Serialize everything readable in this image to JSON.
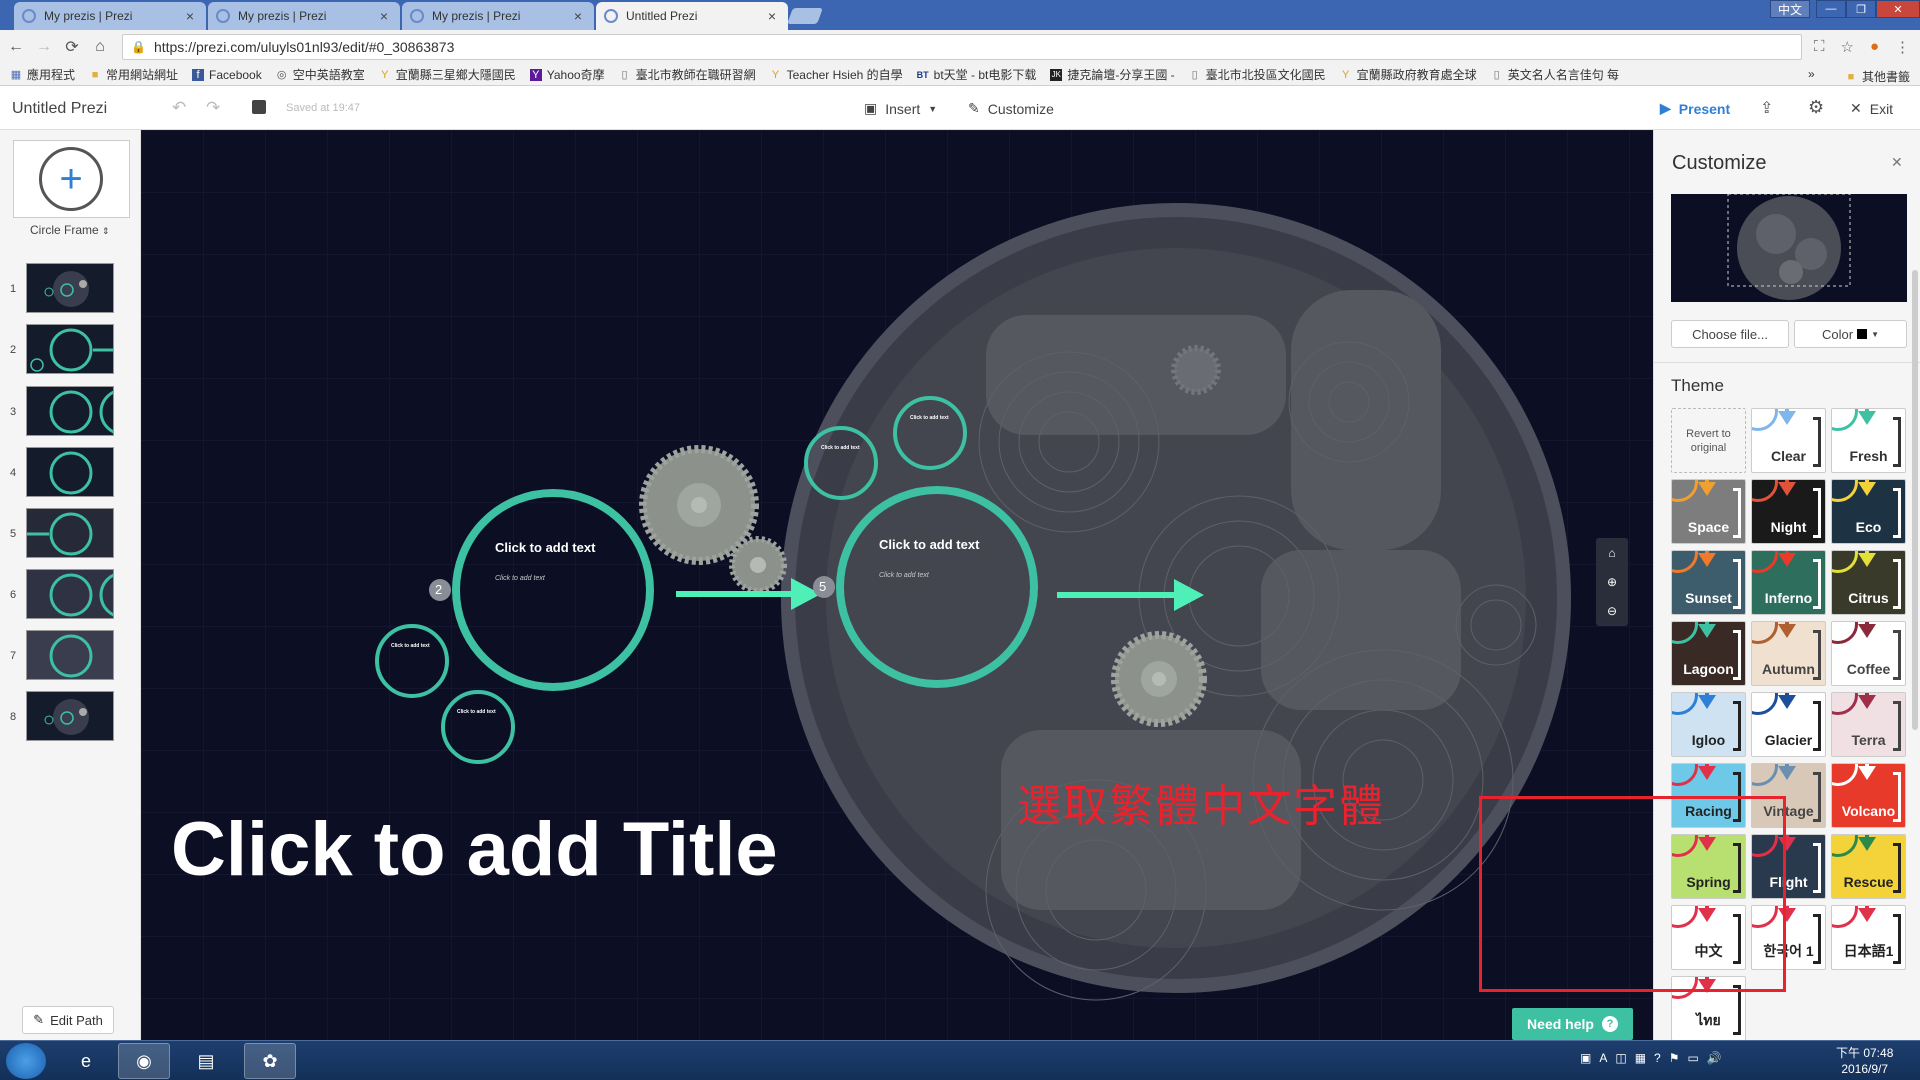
{
  "browser": {
    "tabs": [
      {
        "title": "My prezis | Prezi",
        "active": false
      },
      {
        "title": "My prezis | Prezi",
        "active": false
      },
      {
        "title": "My prezis | Prezi",
        "active": false
      },
      {
        "title": "Untitled Prezi",
        "active": true
      }
    ],
    "ime_label": "中文",
    "url": "https://prezi.com/uluyls01nl93/edit/#0_30863873",
    "bookmarks": [
      {
        "label": "應用程式",
        "icon": "apps-grid-icon"
      },
      {
        "label": "常用網站網址",
        "icon": "folder-icon"
      },
      {
        "label": "Facebook",
        "icon": "facebook-icon"
      },
      {
        "label": "空中英語教室",
        "icon": "globe-icon"
      },
      {
        "label": "宜蘭縣三星鄉大隱國民",
        "icon": "yilan-icon"
      },
      {
        "label": "Yahoo奇摩",
        "icon": "yahoo-icon"
      },
      {
        "label": "臺北市教師在職研習網",
        "icon": "page-icon"
      },
      {
        "label": "Teacher Hsieh 的自學",
        "icon": "yilan-icon"
      },
      {
        "label": "bt天堂 - bt电影下载",
        "icon": "bt-icon"
      },
      {
        "label": "捷克論壇-分享王國 -",
        "icon": "jk-icon"
      },
      {
        "label": "臺北市北投區文化國民",
        "icon": "page-icon"
      },
      {
        "label": "宜蘭縣政府教育處全球",
        "icon": "yilan-icon"
      },
      {
        "label": "英文名人名言佳句 每",
        "icon": "page-icon"
      }
    ],
    "bookmarks_more": "»",
    "other_bookmarks": "其他書籤"
  },
  "toolbar": {
    "title": "Untitled Prezi",
    "saved": "Saved at 19:47",
    "insert": "Insert",
    "customize": "Customize",
    "present": "Present",
    "exit": "Exit"
  },
  "left_panel": {
    "frame_type": "Circle Frame",
    "thumbnails": [
      "1",
      "2",
      "3",
      "4",
      "5",
      "6",
      "7",
      "8"
    ],
    "edit_path": "Edit Path"
  },
  "canvas": {
    "frame1_title": "Click to add text",
    "frame1_sub": "Click to add text",
    "frame2_title": "Click to add text",
    "frame2_sub": "Click to add text",
    "small_text": "Click to add text",
    "step_2": "2",
    "step_5": "5",
    "main_title": "Click to add Title",
    "annotation": "選取繁體中文字體",
    "need_help": "Need help"
  },
  "customize_panel": {
    "title": "Customize",
    "choose_file": "Choose file...",
    "color": "Color",
    "theme_heading": "Theme",
    "revert": "Revert to original",
    "themes": [
      {
        "label": "Clear",
        "bg": "#ffffff",
        "fg": "#333333",
        "accent": "#7fb6ec"
      },
      {
        "label": "Fresh",
        "bg": "#ffffff",
        "fg": "#333333",
        "accent": "#3ec0a3"
      },
      {
        "label": "Space",
        "bg": "#7d7d7d",
        "fg": "#ffffff",
        "accent": "#f0a030"
      },
      {
        "label": "Night",
        "bg": "#1a1a1a",
        "fg": "#ffffff",
        "accent": "#e0523a"
      },
      {
        "label": "Eco",
        "bg": "#1d3344",
        "fg": "#ffffff",
        "accent": "#f3d23a"
      },
      {
        "label": "Sunset",
        "bg": "#3d5d6c",
        "fg": "#ffffff",
        "accent": "#f07a2a"
      },
      {
        "label": "Inferno",
        "bg": "#2d6e5c",
        "fg": "#ffffff",
        "accent": "#e83a2a"
      },
      {
        "label": "Citrus",
        "bg": "#3a3a2a",
        "fg": "#ffffff",
        "accent": "#e3e03a"
      },
      {
        "label": "Lagoon",
        "bg": "#3a2a26",
        "fg": "#ffffff",
        "accent": "#3ec0a3"
      },
      {
        "label": "Autumn",
        "bg": "#efe0d0",
        "fg": "#444444",
        "accent": "#b06030"
      },
      {
        "label": "Coffee",
        "bg": "#ffffff",
        "fg": "#444444",
        "accent": "#8a2a3a"
      },
      {
        "label": "Igloo",
        "bg": "#cfe2f2",
        "fg": "#222222",
        "accent": "#2f7fd6"
      },
      {
        "label": "Glacier",
        "bg": "#ffffff",
        "fg": "#222222",
        "accent": "#1d4f9a"
      },
      {
        "label": "Terra",
        "bg": "#f0e0e4",
        "fg": "#444444",
        "accent": "#a0304a"
      },
      {
        "label": "Racing",
        "bg": "#6ec8e8",
        "fg": "#222222",
        "accent": "#e0304a"
      },
      {
        "label": "Vintage",
        "bg": "#d8c8b8",
        "fg": "#444444",
        "accent": "#6a8fb0"
      },
      {
        "label": "Volcano",
        "bg": "#e83a2a",
        "fg": "#ffffff",
        "accent": "#ffffff"
      },
      {
        "label": "Spring",
        "bg": "#b8e070",
        "fg": "#222222",
        "accent": "#e0304a"
      },
      {
        "label": "Flight",
        "bg": "#2a3a4e",
        "fg": "#ffffff",
        "accent": "#e0304a"
      },
      {
        "label": "Rescue",
        "bg": "#f3d23a",
        "fg": "#222222",
        "accent": "#2a8a4a"
      },
      {
        "label": "中文",
        "bg": "#ffffff",
        "fg": "#222222",
        "accent": "#e0304a"
      },
      {
        "label": "한국어 1",
        "bg": "#ffffff",
        "fg": "#222222",
        "accent": "#e0304a"
      },
      {
        "label": "日本語1",
        "bg": "#ffffff",
        "fg": "#222222",
        "accent": "#e0304a"
      },
      {
        "label": "ไทย",
        "bg": "#ffffff",
        "fg": "#222222",
        "accent": "#e0304a"
      }
    ]
  },
  "taskbar": {
    "time": "下午 07:48",
    "date": "2016/9/7"
  }
}
